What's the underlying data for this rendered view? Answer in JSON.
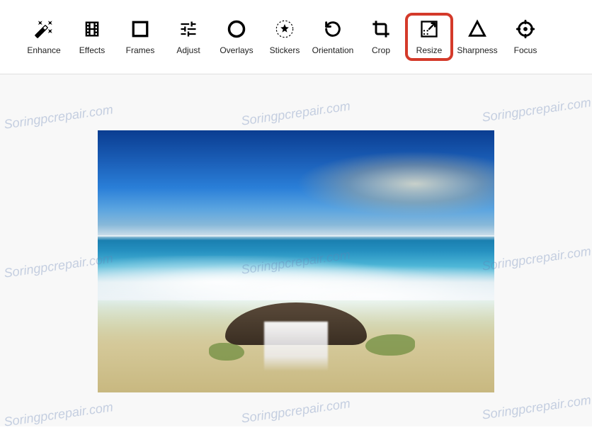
{
  "toolbar": {
    "items": [
      {
        "id": "enhance",
        "label": "Enhance",
        "icon": "magic-wand-icon",
        "highlighted": false
      },
      {
        "id": "effects",
        "label": "Effects",
        "icon": "filmstrip-icon",
        "highlighted": false
      },
      {
        "id": "frames",
        "label": "Frames",
        "icon": "square-icon",
        "highlighted": false
      },
      {
        "id": "adjust",
        "label": "Adjust",
        "icon": "sliders-icon",
        "highlighted": false
      },
      {
        "id": "overlays",
        "label": "Overlays",
        "icon": "circle-icon",
        "highlighted": false
      },
      {
        "id": "stickers",
        "label": "Stickers",
        "icon": "star-badge-icon",
        "highlighted": false
      },
      {
        "id": "orientation",
        "label": "Orientation",
        "icon": "rotate-icon",
        "highlighted": false
      },
      {
        "id": "crop",
        "label": "Crop",
        "icon": "crop-icon",
        "highlighted": false
      },
      {
        "id": "resize",
        "label": "Resize",
        "icon": "resize-icon",
        "highlighted": true
      },
      {
        "id": "sharpness",
        "label": "Sharpness",
        "icon": "triangle-icon",
        "highlighted": false
      },
      {
        "id": "focus",
        "label": "Focus",
        "icon": "target-icon",
        "highlighted": false
      }
    ]
  },
  "watermark": {
    "text": "Soringpcrepair.com"
  }
}
